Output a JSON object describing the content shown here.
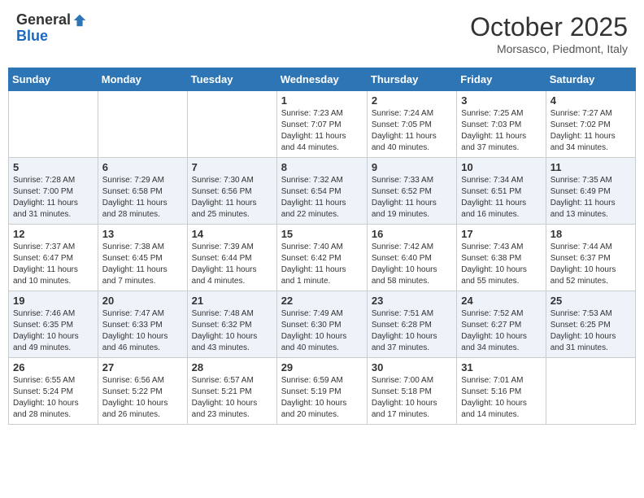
{
  "header": {
    "logo_general": "General",
    "logo_blue": "Blue",
    "month_title": "October 2025",
    "location": "Morsasco, Piedmont, Italy"
  },
  "days_of_week": [
    "Sunday",
    "Monday",
    "Tuesday",
    "Wednesday",
    "Thursday",
    "Friday",
    "Saturday"
  ],
  "weeks": [
    [
      {
        "day": "",
        "info": ""
      },
      {
        "day": "",
        "info": ""
      },
      {
        "day": "",
        "info": ""
      },
      {
        "day": "1",
        "info": "Sunrise: 7:23 AM\nSunset: 7:07 PM\nDaylight: 11 hours\nand 44 minutes."
      },
      {
        "day": "2",
        "info": "Sunrise: 7:24 AM\nSunset: 7:05 PM\nDaylight: 11 hours\nand 40 minutes."
      },
      {
        "day": "3",
        "info": "Sunrise: 7:25 AM\nSunset: 7:03 PM\nDaylight: 11 hours\nand 37 minutes."
      },
      {
        "day": "4",
        "info": "Sunrise: 7:27 AM\nSunset: 7:02 PM\nDaylight: 11 hours\nand 34 minutes."
      }
    ],
    [
      {
        "day": "5",
        "info": "Sunrise: 7:28 AM\nSunset: 7:00 PM\nDaylight: 11 hours\nand 31 minutes."
      },
      {
        "day": "6",
        "info": "Sunrise: 7:29 AM\nSunset: 6:58 PM\nDaylight: 11 hours\nand 28 minutes."
      },
      {
        "day": "7",
        "info": "Sunrise: 7:30 AM\nSunset: 6:56 PM\nDaylight: 11 hours\nand 25 minutes."
      },
      {
        "day": "8",
        "info": "Sunrise: 7:32 AM\nSunset: 6:54 PM\nDaylight: 11 hours\nand 22 minutes."
      },
      {
        "day": "9",
        "info": "Sunrise: 7:33 AM\nSunset: 6:52 PM\nDaylight: 11 hours\nand 19 minutes."
      },
      {
        "day": "10",
        "info": "Sunrise: 7:34 AM\nSunset: 6:51 PM\nDaylight: 11 hours\nand 16 minutes."
      },
      {
        "day": "11",
        "info": "Sunrise: 7:35 AM\nSunset: 6:49 PM\nDaylight: 11 hours\nand 13 minutes."
      }
    ],
    [
      {
        "day": "12",
        "info": "Sunrise: 7:37 AM\nSunset: 6:47 PM\nDaylight: 11 hours\nand 10 minutes."
      },
      {
        "day": "13",
        "info": "Sunrise: 7:38 AM\nSunset: 6:45 PM\nDaylight: 11 hours\nand 7 minutes."
      },
      {
        "day": "14",
        "info": "Sunrise: 7:39 AM\nSunset: 6:44 PM\nDaylight: 11 hours\nand 4 minutes."
      },
      {
        "day": "15",
        "info": "Sunrise: 7:40 AM\nSunset: 6:42 PM\nDaylight: 11 hours\nand 1 minute."
      },
      {
        "day": "16",
        "info": "Sunrise: 7:42 AM\nSunset: 6:40 PM\nDaylight: 10 hours\nand 58 minutes."
      },
      {
        "day": "17",
        "info": "Sunrise: 7:43 AM\nSunset: 6:38 PM\nDaylight: 10 hours\nand 55 minutes."
      },
      {
        "day": "18",
        "info": "Sunrise: 7:44 AM\nSunset: 6:37 PM\nDaylight: 10 hours\nand 52 minutes."
      }
    ],
    [
      {
        "day": "19",
        "info": "Sunrise: 7:46 AM\nSunset: 6:35 PM\nDaylight: 10 hours\nand 49 minutes."
      },
      {
        "day": "20",
        "info": "Sunrise: 7:47 AM\nSunset: 6:33 PM\nDaylight: 10 hours\nand 46 minutes."
      },
      {
        "day": "21",
        "info": "Sunrise: 7:48 AM\nSunset: 6:32 PM\nDaylight: 10 hours\nand 43 minutes."
      },
      {
        "day": "22",
        "info": "Sunrise: 7:49 AM\nSunset: 6:30 PM\nDaylight: 10 hours\nand 40 minutes."
      },
      {
        "day": "23",
        "info": "Sunrise: 7:51 AM\nSunset: 6:28 PM\nDaylight: 10 hours\nand 37 minutes."
      },
      {
        "day": "24",
        "info": "Sunrise: 7:52 AM\nSunset: 6:27 PM\nDaylight: 10 hours\nand 34 minutes."
      },
      {
        "day": "25",
        "info": "Sunrise: 7:53 AM\nSunset: 6:25 PM\nDaylight: 10 hours\nand 31 minutes."
      }
    ],
    [
      {
        "day": "26",
        "info": "Sunrise: 6:55 AM\nSunset: 5:24 PM\nDaylight: 10 hours\nand 28 minutes."
      },
      {
        "day": "27",
        "info": "Sunrise: 6:56 AM\nSunset: 5:22 PM\nDaylight: 10 hours\nand 26 minutes."
      },
      {
        "day": "28",
        "info": "Sunrise: 6:57 AM\nSunset: 5:21 PM\nDaylight: 10 hours\nand 23 minutes."
      },
      {
        "day": "29",
        "info": "Sunrise: 6:59 AM\nSunset: 5:19 PM\nDaylight: 10 hours\nand 20 minutes."
      },
      {
        "day": "30",
        "info": "Sunrise: 7:00 AM\nSunset: 5:18 PM\nDaylight: 10 hours\nand 17 minutes."
      },
      {
        "day": "31",
        "info": "Sunrise: 7:01 AM\nSunset: 5:16 PM\nDaylight: 10 hours\nand 14 minutes."
      },
      {
        "day": "",
        "info": ""
      }
    ]
  ]
}
